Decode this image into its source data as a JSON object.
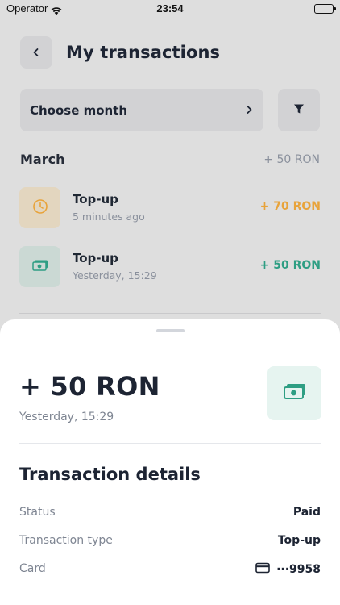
{
  "status_bar": {
    "carrier": "Operator",
    "time": "23:54"
  },
  "header": {
    "title": "My transactions"
  },
  "filters": {
    "month_label": "Choose month"
  },
  "section": {
    "title": "March",
    "total": "+ 50 RON"
  },
  "transactions": [
    {
      "title": "Top-up",
      "subtitle": "5 minutes ago",
      "amount": "+ 70 RON",
      "icon": "clock-icon",
      "color": "#e8a33a"
    },
    {
      "title": "Top-up",
      "subtitle": "Yesterday, 15:29",
      "amount": "+ 50 RON",
      "icon": "cash-icon",
      "color": "#2e9e83"
    }
  ],
  "sheet": {
    "amount": "+ 50 RON",
    "date": "Yesterday, 15:29",
    "icon": "cash-icon",
    "details_title": "Transaction details",
    "details": [
      {
        "label": "Status",
        "value": "Paid"
      },
      {
        "label": "Transaction type",
        "value": "Top-up"
      },
      {
        "label": "Card",
        "value": "···9958",
        "icon": "card-icon"
      }
    ]
  },
  "colors": {
    "accent_green": "#2e9e83",
    "accent_orange": "#e8a33a",
    "text_dark": "#1d2433",
    "text_muted": "#8a909c"
  }
}
